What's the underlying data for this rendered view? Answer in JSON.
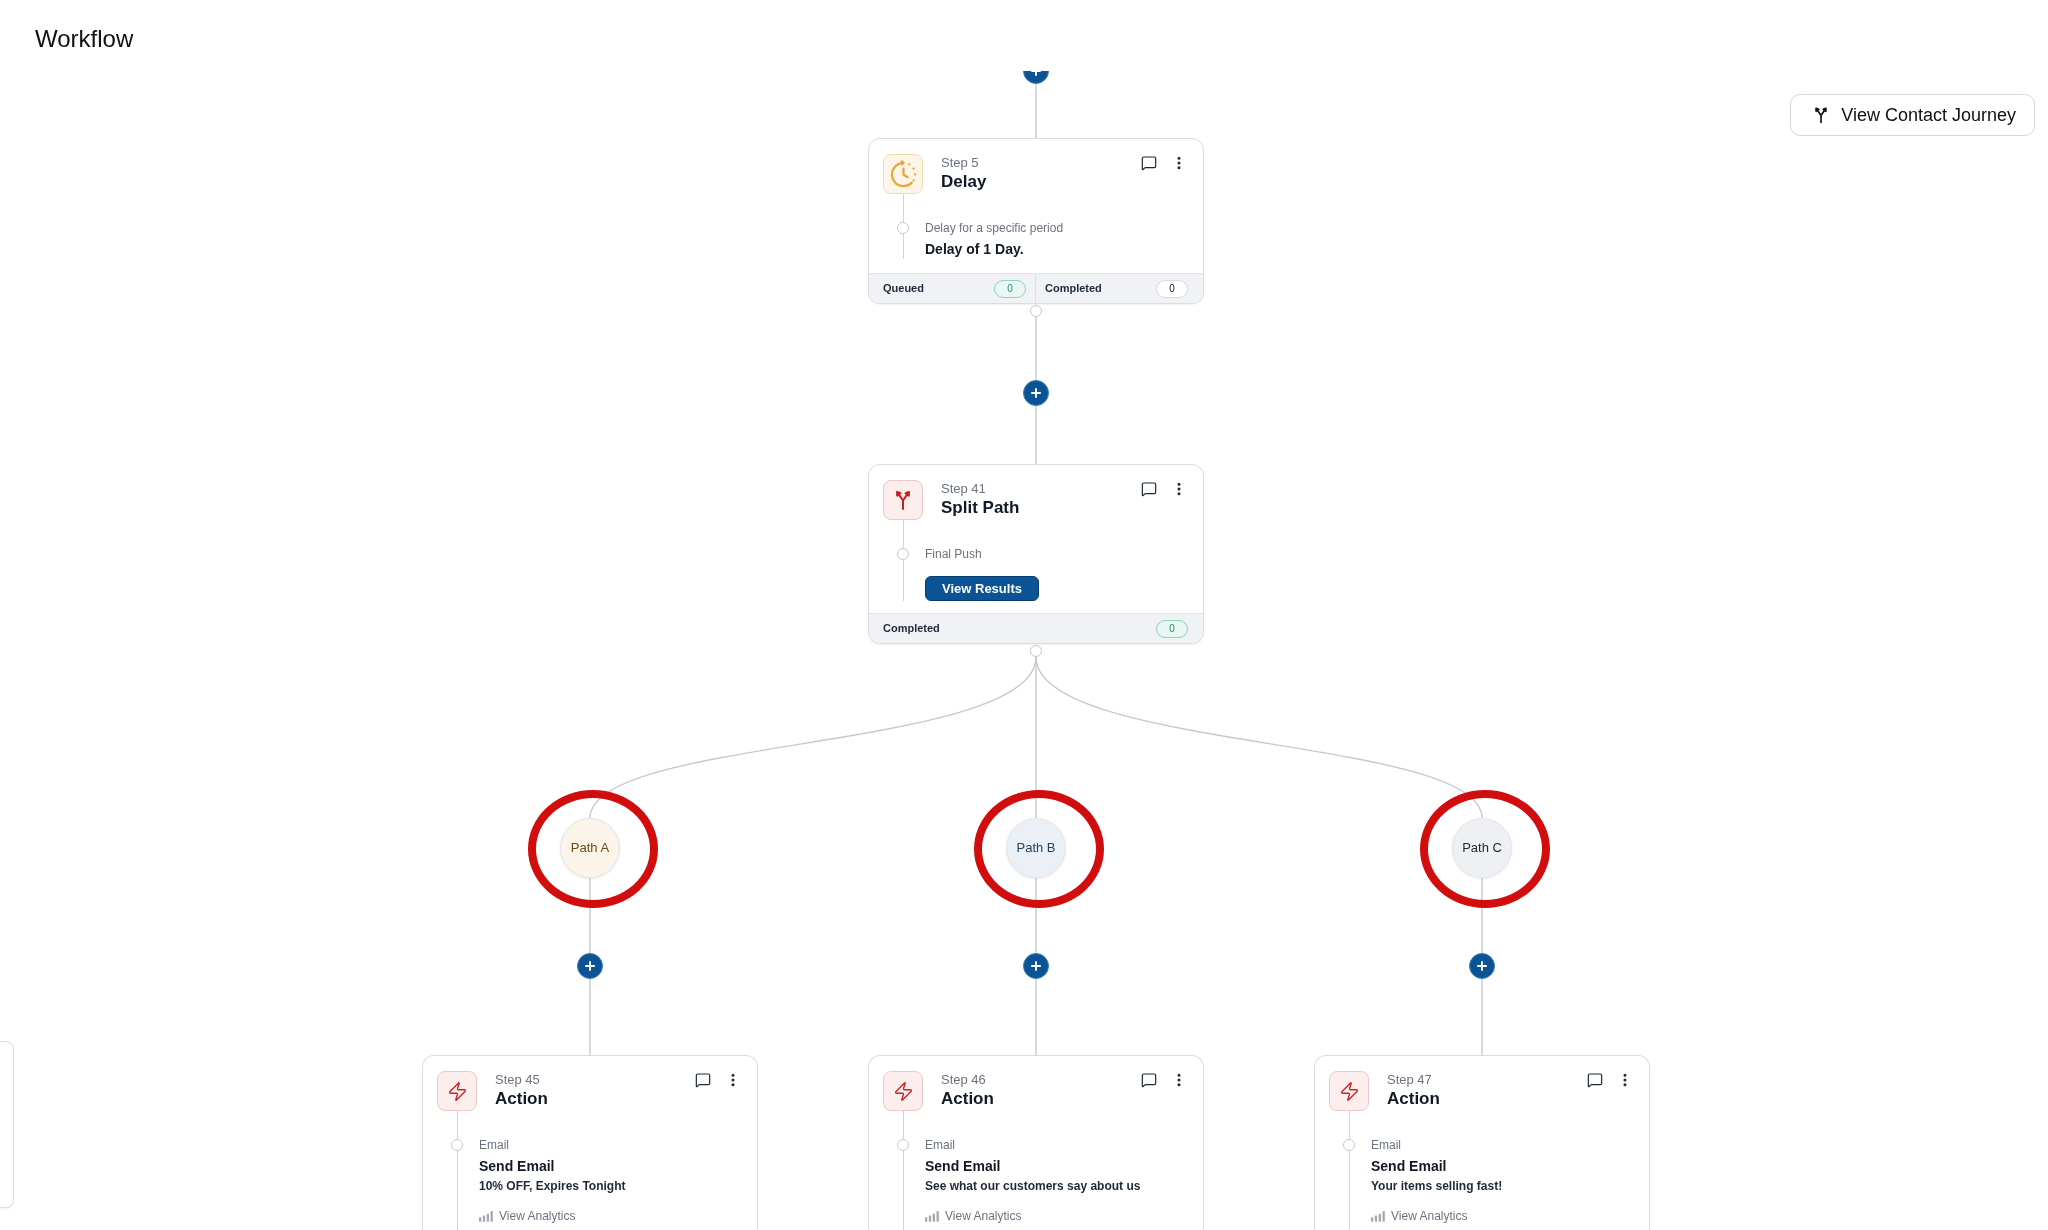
{
  "header": {
    "title": "Workflow"
  },
  "contact_journey_button": {
    "label": "View Contact Journey"
  },
  "steps": [
    {
      "kind": "delay",
      "step": "Step 5",
      "title": "Delay",
      "caption": "Delay for a specific period",
      "detail": "Delay of 1 Day.",
      "counters": [
        {
          "label": "Queued",
          "count": "0",
          "highlighted": true
        },
        {
          "label": "Completed",
          "count": "0",
          "highlighted": false
        }
      ]
    },
    {
      "kind": "split",
      "step": "Step 41",
      "title": "Split Path",
      "caption": "Final Push",
      "button": "View Results",
      "counters": [
        {
          "label": "Completed",
          "count": "0",
          "highlighted": true
        }
      ]
    }
  ],
  "paths": [
    {
      "label": "Path A",
      "color": "#fcf4e8",
      "circled": true,
      "step": {
        "kind": "action",
        "step": "Step 45",
        "title": "Action",
        "caption": "Email",
        "detail": "Send Email",
        "subject": "10% OFF, Expires Tonight",
        "link": "View Analytics"
      }
    },
    {
      "label": "Path B",
      "color": "#eaf0f6",
      "circled": true,
      "step": {
        "kind": "action",
        "step": "Step 46",
        "title": "Action",
        "caption": "Email",
        "detail": "Send Email",
        "subject": "See what our customers say about us",
        "link": "View Analytics"
      }
    },
    {
      "label": "Path C",
      "color": "#eef0f4",
      "circled": true,
      "step": {
        "kind": "action",
        "step": "Step 47",
        "title": "Action",
        "caption": "Email",
        "detail": "Send Email",
        "subject": "Your items selling fast!",
        "link": "View Analytics"
      }
    }
  ]
}
